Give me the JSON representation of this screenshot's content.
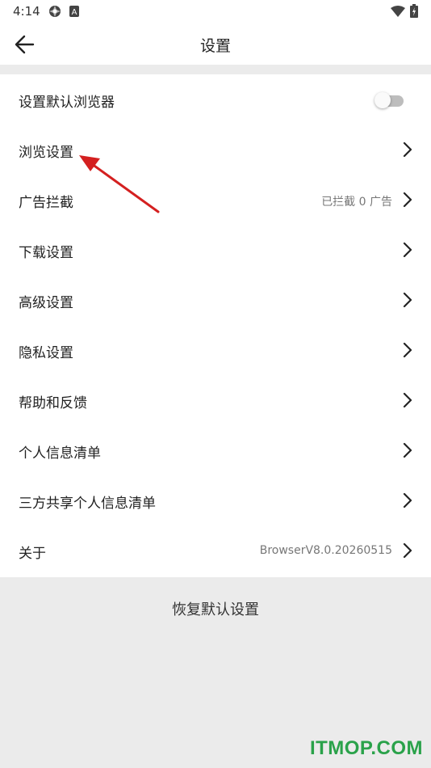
{
  "status_bar": {
    "time": "4:14",
    "icons": [
      "settings-flower-icon",
      "a-badge-icon",
      "wifi-icon",
      "battery-charging-icon"
    ]
  },
  "app_bar": {
    "back_icon": "arrow-left-icon",
    "title": "设置"
  },
  "settings": {
    "default_browser": {
      "label": "设置默认浏览器",
      "toggle_on": false
    },
    "items": [
      {
        "label": "浏览设置",
        "value": ""
      },
      {
        "label": "广告拦截",
        "value": "已拦截 0 广告"
      },
      {
        "label": "下载设置",
        "value": ""
      },
      {
        "label": "高级设置",
        "value": ""
      },
      {
        "label": "隐私设置",
        "value": ""
      },
      {
        "label": "帮助和反馈",
        "value": ""
      },
      {
        "label": "个人信息清单",
        "value": ""
      },
      {
        "label": "三方共享个人信息清单",
        "value": ""
      },
      {
        "label": "关于",
        "value": "BrowserV8.0.20260515"
      }
    ]
  },
  "restore_button": "恢复默认设置",
  "watermark": "ITMOP.COM",
  "colors": {
    "annotation_arrow": "#d42020",
    "watermark": "#2aa24a",
    "background": "#ebebeb"
  }
}
